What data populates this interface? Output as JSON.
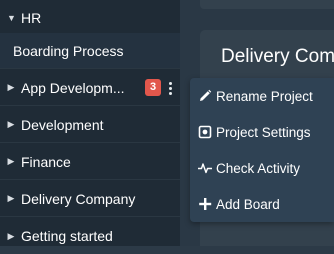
{
  "sidebar": {
    "items": [
      {
        "label": "HR",
        "expanded": true
      },
      {
        "label": "Boarding Process"
      },
      {
        "label": "App Developm...",
        "badge": "3"
      },
      {
        "label": "Development"
      },
      {
        "label": "Finance"
      },
      {
        "label": "Delivery Company"
      },
      {
        "label": "Getting started"
      }
    ]
  },
  "main": {
    "card_title": "Delivery Com"
  },
  "context_menu": {
    "items": [
      {
        "label": "Rename Project",
        "icon": "pencil-icon"
      },
      {
        "label": "Project Settings",
        "icon": "settings-icon"
      },
      {
        "label": "Check Activity",
        "icon": "activity-icon"
      },
      {
        "label": "Add Board",
        "icon": "plus-icon"
      }
    ]
  },
  "colors": {
    "sidebar_bg": "#1f2b36",
    "menu_bg": "#2f4254",
    "badge": "#e2574c",
    "card_bg": "#33414d"
  }
}
